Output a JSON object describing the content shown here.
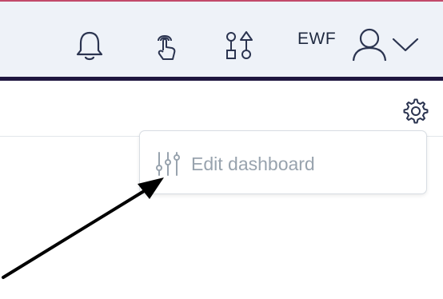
{
  "header": {
    "icons": {
      "notifications": "bell-icon",
      "touch": "touch-hand-icon",
      "shapes": "shapes-icon",
      "user": "user-icon",
      "dropdown": "chevron-down-icon"
    },
    "user_initials": "EWF"
  },
  "toolbar": {
    "settings_icon": "gear-icon"
  },
  "settings_menu": {
    "items": [
      {
        "icon": "sliders-icon",
        "label": "Edit dashboard"
      }
    ]
  },
  "annotation": {
    "arrow_color": "#000000"
  },
  "colors": {
    "topbar_bg": "#eef2f8",
    "topbar_border": "#1e1640",
    "accent_top": "#c24a6a",
    "icon_color": "#2b3450",
    "menu_text": "#98a3ae"
  }
}
